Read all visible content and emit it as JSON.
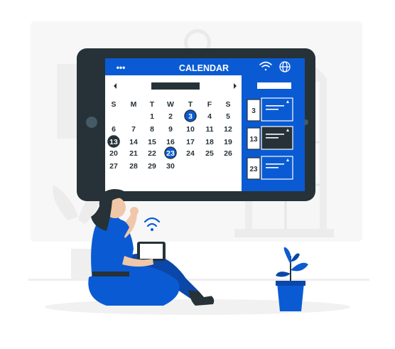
{
  "header": {
    "title": "CALENDAR",
    "menu_dots": "•••"
  },
  "calendar": {
    "weekdays": [
      "S",
      "M",
      "T",
      "W",
      "T",
      "F",
      "S"
    ],
    "weeks": [
      [
        "",
        "",
        "1",
        "2",
        "3",
        "4",
        "5"
      ],
      [
        "6",
        "7",
        "8",
        "9",
        "10",
        "11",
        "12"
      ],
      [
        "13",
        "14",
        "15",
        "16",
        "17",
        "18",
        "19"
      ],
      [
        "20",
        "21",
        "22",
        "23",
        "24",
        "25",
        "26"
      ],
      [
        "27",
        "28",
        "29",
        "30",
        "",
        "",
        ""
      ]
    ],
    "highlighted_blue": [
      "3",
      "23"
    ],
    "highlighted_dark": [
      "13"
    ]
  },
  "events": [
    {
      "day": "3",
      "style": "blue"
    },
    {
      "day": "13",
      "style": "dark"
    },
    {
      "day": "23",
      "style": "blue"
    }
  ],
  "icons": {
    "wifi": "wifi-icon",
    "globe": "globe-icon",
    "prev": "chevron-left-icon",
    "next": "chevron-right-icon"
  },
  "colors": {
    "accent": "#0a5bd3",
    "dark": "#263238",
    "light_bg": "#f5f5f5",
    "calendar_bg": "#ffffff"
  }
}
